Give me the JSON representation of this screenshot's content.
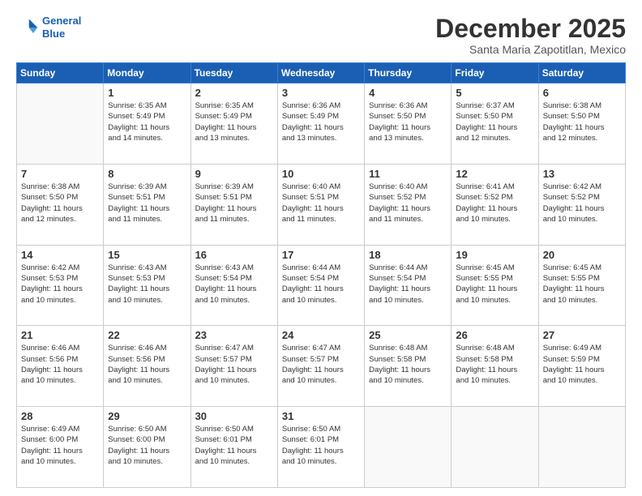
{
  "logo": {
    "line1": "General",
    "line2": "Blue"
  },
  "title": "December 2025",
  "subtitle": "Santa Maria Zapotitlan, Mexico",
  "weekdays": [
    "Sunday",
    "Monday",
    "Tuesday",
    "Wednesday",
    "Thursday",
    "Friday",
    "Saturday"
  ],
  "weeks": [
    [
      {
        "day": "",
        "info": ""
      },
      {
        "day": "1",
        "info": "Sunrise: 6:35 AM\nSunset: 5:49 PM\nDaylight: 11 hours\nand 14 minutes."
      },
      {
        "day": "2",
        "info": "Sunrise: 6:35 AM\nSunset: 5:49 PM\nDaylight: 11 hours\nand 13 minutes."
      },
      {
        "day": "3",
        "info": "Sunrise: 6:36 AM\nSunset: 5:49 PM\nDaylight: 11 hours\nand 13 minutes."
      },
      {
        "day": "4",
        "info": "Sunrise: 6:36 AM\nSunset: 5:50 PM\nDaylight: 11 hours\nand 13 minutes."
      },
      {
        "day": "5",
        "info": "Sunrise: 6:37 AM\nSunset: 5:50 PM\nDaylight: 11 hours\nand 12 minutes."
      },
      {
        "day": "6",
        "info": "Sunrise: 6:38 AM\nSunset: 5:50 PM\nDaylight: 11 hours\nand 12 minutes."
      }
    ],
    [
      {
        "day": "7",
        "info": "Sunrise: 6:38 AM\nSunset: 5:50 PM\nDaylight: 11 hours\nand 12 minutes."
      },
      {
        "day": "8",
        "info": "Sunrise: 6:39 AM\nSunset: 5:51 PM\nDaylight: 11 hours\nand 11 minutes."
      },
      {
        "day": "9",
        "info": "Sunrise: 6:39 AM\nSunset: 5:51 PM\nDaylight: 11 hours\nand 11 minutes."
      },
      {
        "day": "10",
        "info": "Sunrise: 6:40 AM\nSunset: 5:51 PM\nDaylight: 11 hours\nand 11 minutes."
      },
      {
        "day": "11",
        "info": "Sunrise: 6:40 AM\nSunset: 5:52 PM\nDaylight: 11 hours\nand 11 minutes."
      },
      {
        "day": "12",
        "info": "Sunrise: 6:41 AM\nSunset: 5:52 PM\nDaylight: 11 hours\nand 10 minutes."
      },
      {
        "day": "13",
        "info": "Sunrise: 6:42 AM\nSunset: 5:52 PM\nDaylight: 11 hours\nand 10 minutes."
      }
    ],
    [
      {
        "day": "14",
        "info": "Sunrise: 6:42 AM\nSunset: 5:53 PM\nDaylight: 11 hours\nand 10 minutes."
      },
      {
        "day": "15",
        "info": "Sunrise: 6:43 AM\nSunset: 5:53 PM\nDaylight: 11 hours\nand 10 minutes."
      },
      {
        "day": "16",
        "info": "Sunrise: 6:43 AM\nSunset: 5:54 PM\nDaylight: 11 hours\nand 10 minutes."
      },
      {
        "day": "17",
        "info": "Sunrise: 6:44 AM\nSunset: 5:54 PM\nDaylight: 11 hours\nand 10 minutes."
      },
      {
        "day": "18",
        "info": "Sunrise: 6:44 AM\nSunset: 5:54 PM\nDaylight: 11 hours\nand 10 minutes."
      },
      {
        "day": "19",
        "info": "Sunrise: 6:45 AM\nSunset: 5:55 PM\nDaylight: 11 hours\nand 10 minutes."
      },
      {
        "day": "20",
        "info": "Sunrise: 6:45 AM\nSunset: 5:55 PM\nDaylight: 11 hours\nand 10 minutes."
      }
    ],
    [
      {
        "day": "21",
        "info": "Sunrise: 6:46 AM\nSunset: 5:56 PM\nDaylight: 11 hours\nand 10 minutes."
      },
      {
        "day": "22",
        "info": "Sunrise: 6:46 AM\nSunset: 5:56 PM\nDaylight: 11 hours\nand 10 minutes."
      },
      {
        "day": "23",
        "info": "Sunrise: 6:47 AM\nSunset: 5:57 PM\nDaylight: 11 hours\nand 10 minutes."
      },
      {
        "day": "24",
        "info": "Sunrise: 6:47 AM\nSunset: 5:57 PM\nDaylight: 11 hours\nand 10 minutes."
      },
      {
        "day": "25",
        "info": "Sunrise: 6:48 AM\nSunset: 5:58 PM\nDaylight: 11 hours\nand 10 minutes."
      },
      {
        "day": "26",
        "info": "Sunrise: 6:48 AM\nSunset: 5:58 PM\nDaylight: 11 hours\nand 10 minutes."
      },
      {
        "day": "27",
        "info": "Sunrise: 6:49 AM\nSunset: 5:59 PM\nDaylight: 11 hours\nand 10 minutes."
      }
    ],
    [
      {
        "day": "28",
        "info": "Sunrise: 6:49 AM\nSunset: 6:00 PM\nDaylight: 11 hours\nand 10 minutes."
      },
      {
        "day": "29",
        "info": "Sunrise: 6:50 AM\nSunset: 6:00 PM\nDaylight: 11 hours\nand 10 minutes."
      },
      {
        "day": "30",
        "info": "Sunrise: 6:50 AM\nSunset: 6:01 PM\nDaylight: 11 hours\nand 10 minutes."
      },
      {
        "day": "31",
        "info": "Sunrise: 6:50 AM\nSunset: 6:01 PM\nDaylight: 11 hours\nand 10 minutes."
      },
      {
        "day": "",
        "info": ""
      },
      {
        "day": "",
        "info": ""
      },
      {
        "day": "",
        "info": ""
      }
    ]
  ]
}
